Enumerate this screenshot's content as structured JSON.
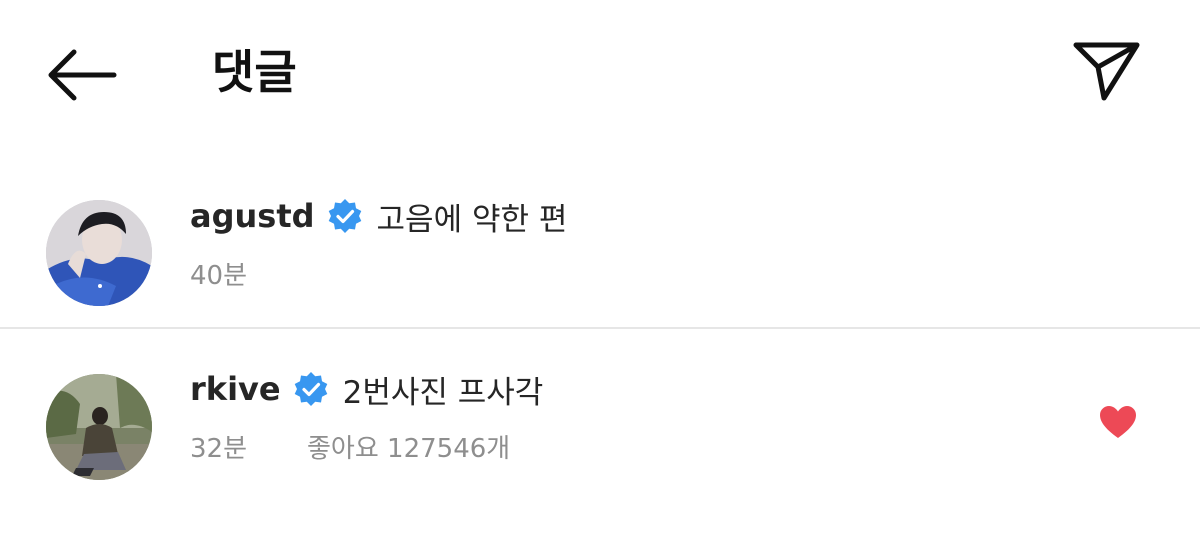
{
  "header": {
    "title": "댓글",
    "back_icon": "arrow-left-icon",
    "send_icon": "paper-plane-icon"
  },
  "comments": [
    {
      "username": "agustd",
      "verified": true,
      "text": "고음에 약한 편",
      "time": "40분",
      "avatar": "avatar-photo"
    },
    {
      "username": "rkive",
      "verified": true,
      "text": "2번사진 프사각",
      "time": "32분",
      "likes": "좋아요 127546개",
      "liked": true,
      "avatar": "avatar-photo"
    }
  ],
  "colors": {
    "verified_badge": "#3897f0",
    "heart": "#ed4956",
    "meta_text": "#8e8e8e",
    "divider": "#e6e6e6"
  }
}
